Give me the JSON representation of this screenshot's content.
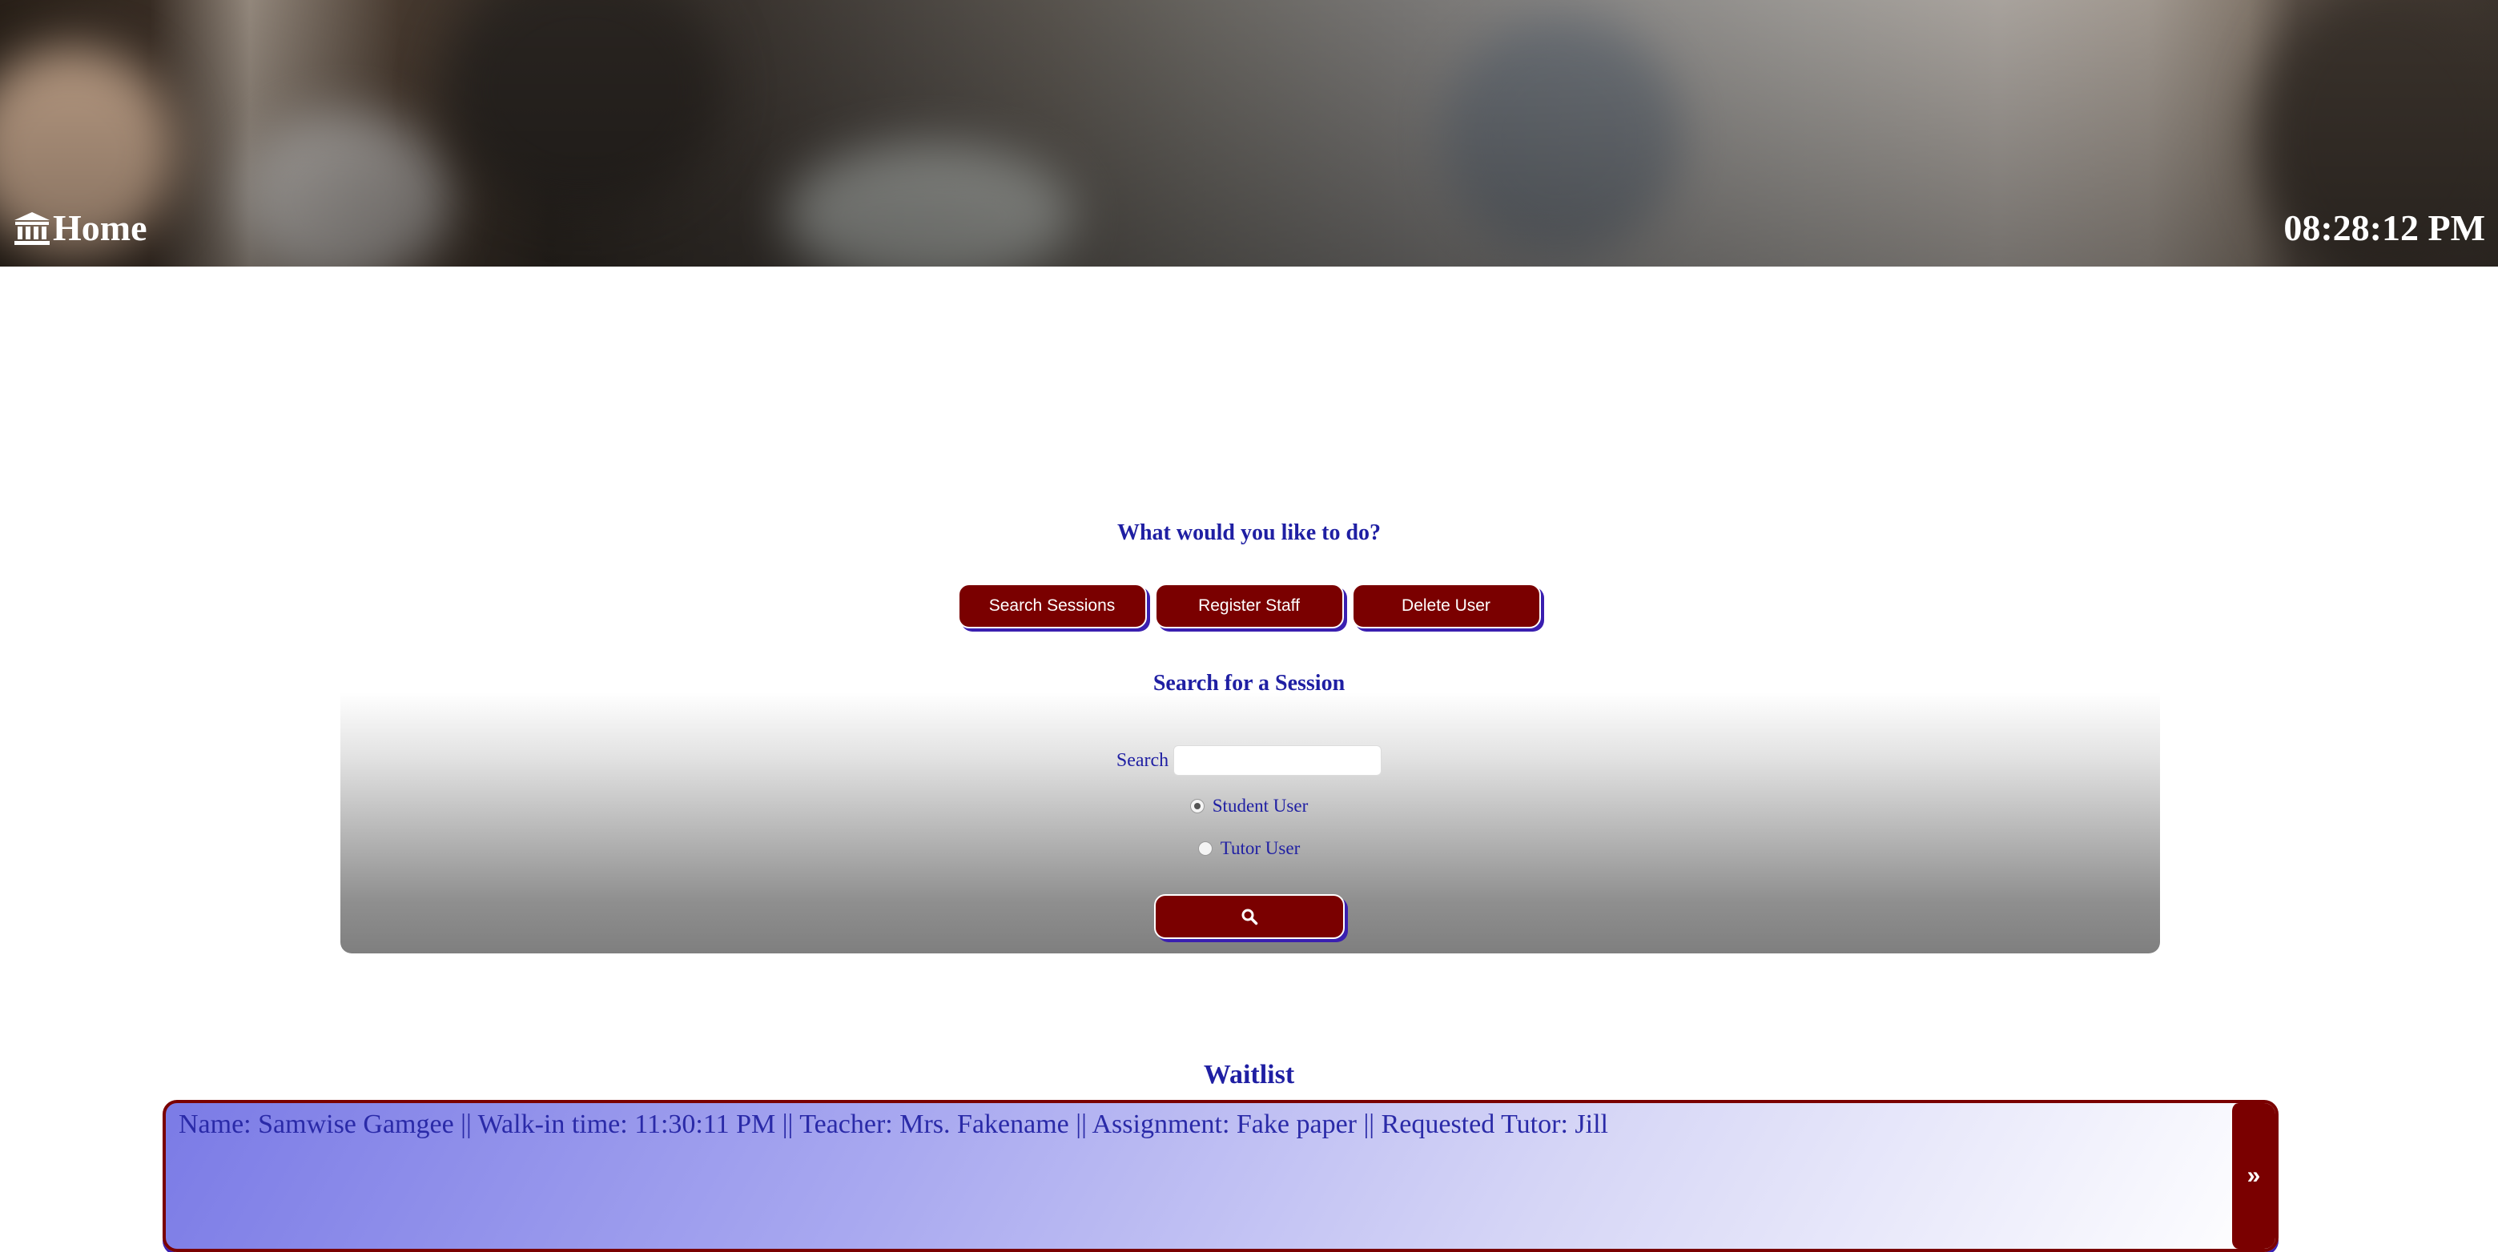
{
  "header": {
    "home_label": "Home",
    "clock": "08:28:12 PM"
  },
  "main": {
    "prompt": "What would you like to do?",
    "actions": [
      {
        "label": "Search Sessions"
      },
      {
        "label": "Register Staff"
      },
      {
        "label": "Delete User"
      }
    ]
  },
  "search_panel": {
    "title": "Search for a Session",
    "search_label": "Search",
    "search_value": "",
    "options": [
      {
        "label": "Student User",
        "checked": true
      },
      {
        "label": "Tutor User",
        "checked": false
      }
    ],
    "submit_icon": "search-icon"
  },
  "waitlist": {
    "title": "Waitlist",
    "entries": [
      {
        "text": "Name: Samwise Gamgee || Walk-in time: 11:30:11 PM || Teacher: Mrs. Fakename || Assignment: Fake paper || Requested Tutor: Jill"
      }
    ],
    "next_label": "»"
  },
  "colors": {
    "accent_maroon": "#7a0000",
    "text_blue": "#1f1fa3",
    "shadow_purple": "#3a1fb0"
  }
}
